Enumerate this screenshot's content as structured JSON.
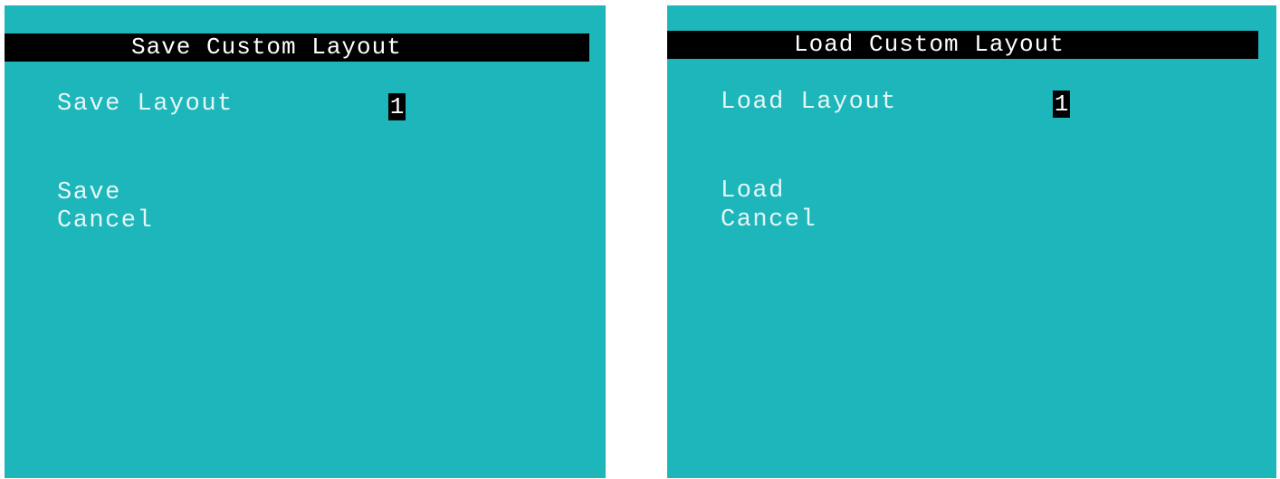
{
  "save_panel": {
    "title": "Save Custom Layout",
    "layout_label": "Save Layout",
    "layout_value": "1",
    "actions": {
      "primary": "Save",
      "cancel": "Cancel"
    }
  },
  "load_panel": {
    "title": "Load Custom Layout",
    "layout_label": "Load Layout",
    "layout_value": "1",
    "actions": {
      "primary": "Load",
      "cancel": "Cancel"
    }
  },
  "colors": {
    "panel_background": "#1db6bb",
    "title_bar": "#000000",
    "text": "#e6f7f7",
    "selection": "#000000"
  }
}
